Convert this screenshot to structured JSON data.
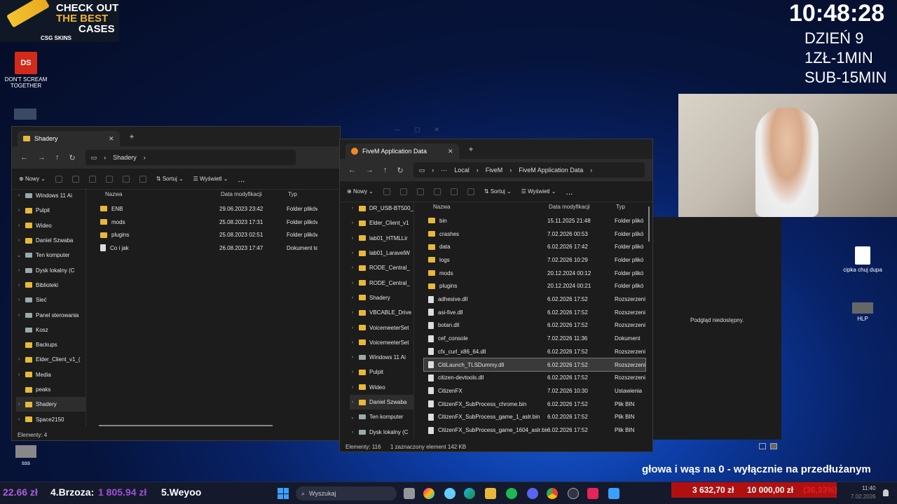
{
  "overlay": {
    "clock": "10:48:28",
    "day": "DZIEŃ 9",
    "rate1": "1ZŁ-1MIN",
    "rate2": "SUB-15MIN",
    "ad_line1": "CHECK OUT",
    "ad_line2": "THE BEST",
    "ad_line3": "CASES",
    "ad_brand": "CSG SKINS",
    "ticker": "głowa i wąs na 0 - wyłącznie na przedłużanym",
    "bottom_left_amount": "22.66 zł",
    "bottom_rank4": "4.Brzoza:",
    "bottom_rank4_amount": "1 805.94 zł",
    "bottom_rank5": "5.Weyoo",
    "donation_amount": "3 632,70 zł",
    "goal_amount": "10 000,00 zł",
    "goal_percent": "(36,33%)"
  },
  "desktop": {
    "icons": [
      {
        "label": "DON'T SCREAM TOGETHER"
      },
      {
        "label": "sss"
      },
      {
        "label": "cipka chuj dupa"
      },
      {
        "label": "HLP"
      }
    ],
    "preview_text": "Podgląd niedostępny."
  },
  "win1": {
    "tab": "Shadery",
    "breadcrumb": "Shadery",
    "toolbar": {
      "new": "Nowy",
      "sort": "Sortuj",
      "view": "Wyświetl",
      "more": "..."
    },
    "sidebar": [
      {
        "label": "Windows 11 Ai",
        "type": "drive",
        "chev": "›"
      },
      {
        "label": "Pulpit",
        "type": "folder",
        "chev": "›"
      },
      {
        "label": "Wideo",
        "type": "folder",
        "chev": "›"
      },
      {
        "label": "Daniel Szwaba",
        "type": "folder",
        "chev": "›"
      },
      {
        "label": "Ten komputer",
        "type": "drive",
        "chev": "⌄"
      },
      {
        "label": "Dysk lokalny (C",
        "type": "drive",
        "chev": "›"
      },
      {
        "label": "Biblioteki",
        "type": "folder",
        "chev": "›"
      },
      {
        "label": "Sieć",
        "type": "drive",
        "chev": "›"
      },
      {
        "label": "Panel sterowania",
        "type": "drive",
        "chev": "›"
      },
      {
        "label": "Kosz",
        "type": "drive",
        "chev": ""
      },
      {
        "label": "Backups",
        "type": "folder",
        "chev": ""
      },
      {
        "label": "Elder_Client_v1_(",
        "type": "folder",
        "chev": "›"
      },
      {
        "label": "Media",
        "type": "folder",
        "chev": "›"
      },
      {
        "label": "peaks",
        "type": "folder",
        "chev": ""
      },
      {
        "label": "Shadery",
        "type": "folder",
        "chev": "›"
      },
      {
        "label": "Space2150",
        "type": "folder",
        "chev": "›"
      }
    ],
    "columns": {
      "name": "Nazwa",
      "date": "Data modyfikacji",
      "type": "Typ"
    },
    "files": [
      {
        "name": "ENB",
        "date": "29.06.2023 23:42",
        "type": "Folder plików",
        "kind": "folder"
      },
      {
        "name": "mods",
        "date": "25.08.2023 17:31",
        "type": "Folder plików",
        "kind": "folder"
      },
      {
        "name": "plugins",
        "date": "25.08.2023 02:51",
        "type": "Folder plików",
        "kind": "folder"
      },
      {
        "name": "Co i jak",
        "date": "26.08.2023 17:47",
        "type": "Dokument teks",
        "kind": "file"
      }
    ],
    "status": "Elementy: 4"
  },
  "win2": {
    "tab": "FiveM Application Data",
    "breadcrumb": [
      "Local",
      "FiveM",
      "FiveM Application Data"
    ],
    "toolbar": {
      "new": "Nowy",
      "sort": "Sortuj",
      "view": "Wyświetl",
      "more": "..."
    },
    "sidebar": [
      {
        "label": "DR_USB-BT500_",
        "type": "folder",
        "chev": "›"
      },
      {
        "label": "Elder_Client_v1",
        "type": "folder",
        "chev": "›"
      },
      {
        "label": "lab01_HTMLLir",
        "type": "folder",
        "chev": "›"
      },
      {
        "label": "lab01_LaravelW",
        "type": "folder",
        "chev": "›"
      },
      {
        "label": "RODE_Central_",
        "type": "folder",
        "chev": "›"
      },
      {
        "label": "RODE_Central_",
        "type": "folder",
        "chev": "›"
      },
      {
        "label": "Shadery",
        "type": "folder",
        "chev": "›"
      },
      {
        "label": "VBCABLE_Drive",
        "type": "folder",
        "chev": "›"
      },
      {
        "label": "VoicemeeterSet",
        "type": "folder",
        "chev": "›"
      },
      {
        "label": "VoicemeeterSet",
        "type": "folder",
        "chev": "›"
      },
      {
        "label": "Windows 11 Ai",
        "type": "drive",
        "chev": "›"
      },
      {
        "label": "Pulpit",
        "type": "folder",
        "chev": "›"
      },
      {
        "label": "Wideo",
        "type": "folder",
        "chev": "›"
      },
      {
        "label": "Daniel Szwaba",
        "type": "folder",
        "chev": "›"
      },
      {
        "label": "Ten komputer",
        "type": "drive",
        "chev": "⌄"
      },
      {
        "label": "Dysk lokalny (C",
        "type": "drive",
        "chev": "›"
      }
    ],
    "columns": {
      "name": "Nazwa",
      "date": "Data modyfikacji",
      "type": "Typ"
    },
    "files": [
      {
        "name": "bin",
        "date": "15.11.2025 21:48",
        "type": "Folder plikó",
        "kind": "folder"
      },
      {
        "name": "crashes",
        "date": "7.02.2026 00:53",
        "type": "Folder plikó",
        "kind": "folder"
      },
      {
        "name": "data",
        "date": "6.02.2026 17:42",
        "type": "Folder plikó",
        "kind": "folder"
      },
      {
        "name": "logs",
        "date": "7.02.2026 10:29",
        "type": "Folder plikó",
        "kind": "folder"
      },
      {
        "name": "mods",
        "date": "20.12.2024 00:12",
        "type": "Folder plikó",
        "kind": "folder"
      },
      {
        "name": "plugins",
        "date": "20.12.2024 00:21",
        "type": "Folder plikó",
        "kind": "folder"
      },
      {
        "name": "adhesive.dll",
        "date": "6.02.2026 17:52",
        "type": "Rozszerzeni",
        "kind": "file"
      },
      {
        "name": "asi-five.dll",
        "date": "6.02.2026 17:52",
        "type": "Rozszerzeni",
        "kind": "file"
      },
      {
        "name": "botan.dll",
        "date": "6.02.2026 17:52",
        "type": "Rozszerzeni",
        "kind": "file"
      },
      {
        "name": "cef_console",
        "date": "7.02.2026 11:36",
        "type": "Dokument",
        "kind": "file"
      },
      {
        "name": "cfx_curl_x86_64.dll",
        "date": "6.02.2026 17:52",
        "type": "Rozszerzeni",
        "kind": "file"
      },
      {
        "name": "CitiLaunch_TLSDummy.dll",
        "date": "6.02.2026 17:52",
        "type": "Rozszerzeni",
        "kind": "file",
        "selected": true
      },
      {
        "name": "citizen-devtools.dll",
        "date": "6.02.2026 17:52",
        "type": "Rozszerzeni",
        "kind": "file"
      },
      {
        "name": "CitizenFX",
        "date": "7.02.2026 10:30",
        "type": "Ustawienia",
        "kind": "file"
      },
      {
        "name": "CitizenFX_SubProcess_chrome.bin",
        "date": "6.02.2026 17:52",
        "type": "Plik BIN",
        "kind": "file"
      },
      {
        "name": "CitizenFX_SubProcess_game_1_aslr.bin",
        "date": "6.02.2026 17:52",
        "type": "Plik BIN",
        "kind": "file"
      },
      {
        "name": "CitizenFX_SubProcess_game_1604_aslr.bin",
        "date": "6.02.2026 17:52",
        "type": "Plik BIN",
        "kind": "file"
      }
    ],
    "status_count": "Elementy: 116",
    "status_selected": "1 zaznaczony element 142 KB"
  },
  "taskbar": {
    "search_placeholder": "Wyszukaj",
    "time": "11:40",
    "date": "7.02.2026"
  }
}
